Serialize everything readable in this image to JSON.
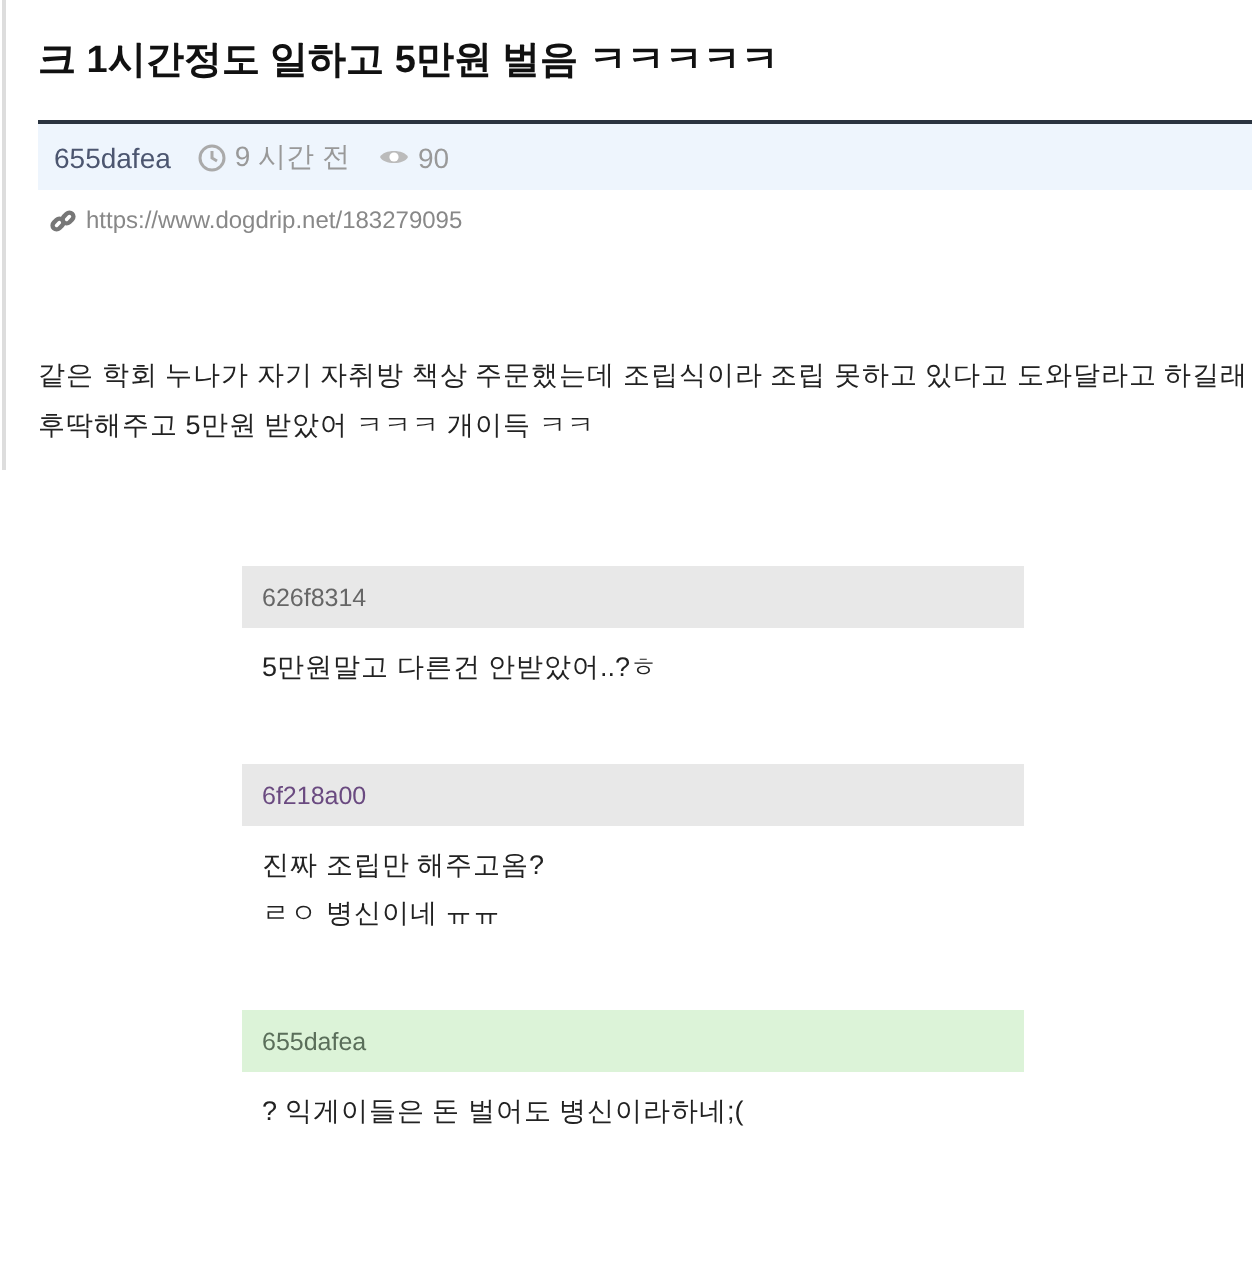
{
  "post": {
    "title": "크 1시간정도 일하고 5만원 벌음 ㅋㅋㅋㅋㅋ",
    "author": "655dafea",
    "time": "9 시간 전",
    "views": "90",
    "url": "https://www.dogdrip.net/183279095",
    "body": [
      "같은 학회 누나가 자기 자취방 책상 주문했는데 조립식이라 조립 못하고 있다고 도와달라고 하길래",
      "후딱해주고 5만원 받았어 ㅋㅋㅋ 개이득 ㅋㅋ"
    ]
  },
  "comments": [
    {
      "author": "626f8314",
      "color": "#666666",
      "is_post_author": false,
      "lines": [
        "5만원말고 다른건 안받았어..?ㅎ"
      ]
    },
    {
      "author": "6f218a00",
      "color": "#6a4a80",
      "is_post_author": false,
      "lines": [
        "진짜 조립만 해주고옴?",
        "ㄹㅇ 병신이네 ㅠㅠ"
      ]
    },
    {
      "author": "655dafea",
      "color": "#5a6e5a",
      "is_post_author": true,
      "lines": [
        "? 익게이들은 돈 벌어도 병신이라하네;("
      ]
    }
  ]
}
